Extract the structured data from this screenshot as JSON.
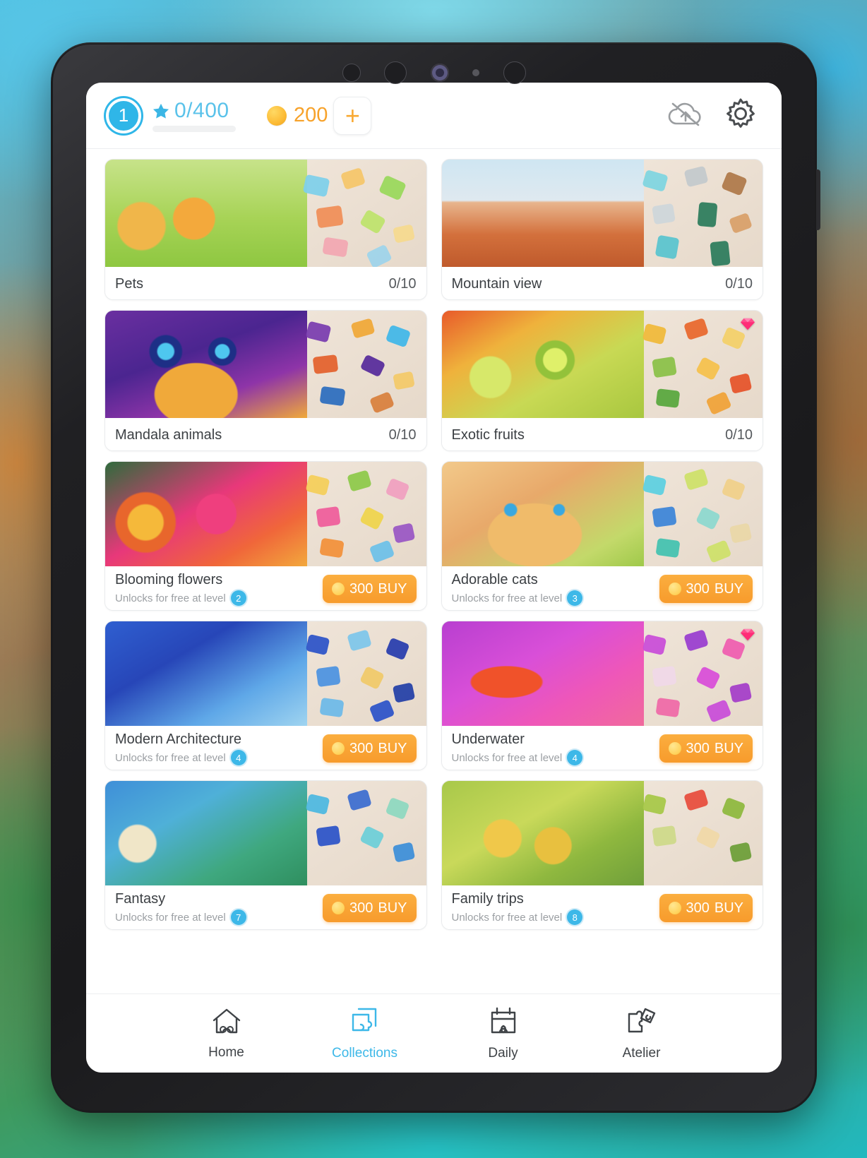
{
  "app": {
    "topbar": {
      "level": "1",
      "star_progress": "0/400",
      "star_icon": "star-icon",
      "coins": "200",
      "coin_icon": "coin-icon",
      "add_coins_label": "+",
      "cloud_off_icon": "cloud-off-icon",
      "settings_icon": "gear-icon"
    },
    "collections": [
      {
        "title": "Pets",
        "count": "0/10",
        "locked": false,
        "gem": false
      },
      {
        "title": "Mountain view",
        "count": "0/10",
        "locked": false,
        "gem": false
      },
      {
        "title": "Mandala animals",
        "count": "0/10",
        "locked": false,
        "gem": false
      },
      {
        "title": "Exotic fruits",
        "count": "0/10",
        "locked": false,
        "gem": true
      },
      {
        "title": "Blooming flowers",
        "unlock_text": "Unlocks for free at level",
        "unlock_level": "2",
        "price": "300",
        "buy_label": "BUY",
        "locked": true,
        "gem": false
      },
      {
        "title": "Adorable cats",
        "unlock_text": "Unlocks for free at level",
        "unlock_level": "3",
        "price": "300",
        "buy_label": "BUY",
        "locked": true,
        "gem": false
      },
      {
        "title": "Modern Architecture",
        "unlock_text": "Unlocks for free at level",
        "unlock_level": "4",
        "price": "300",
        "buy_label": "BUY",
        "locked": true,
        "gem": false
      },
      {
        "title": "Underwater",
        "unlock_text": "Unlocks for free at level",
        "unlock_level": "4",
        "price": "300",
        "buy_label": "BUY",
        "locked": true,
        "gem": true
      },
      {
        "title": "Fantasy",
        "unlock_text": "Unlocks for free at level",
        "unlock_level": "7",
        "price": "300",
        "buy_label": "BUY",
        "locked": true,
        "gem": false
      },
      {
        "title": "Family trips",
        "unlock_text": "Unlocks for free at level",
        "unlock_level": "8",
        "price": "300",
        "buy_label": "BUY",
        "locked": true,
        "gem": false
      }
    ],
    "nav": [
      {
        "label": "Home",
        "icon": "home-puzzle-icon",
        "active": false
      },
      {
        "label": "Collections",
        "icon": "collections-icon",
        "active": true
      },
      {
        "label": "Daily",
        "icon": "calendar-puzzle-icon",
        "active": false
      },
      {
        "label": "Atelier",
        "icon": "atelier-puzzle-icon",
        "active": false
      }
    ],
    "colors": {
      "accent_blue": "#3db8e8",
      "accent_orange": "#f79b2c",
      "coin_yellow": "#fcbb35",
      "text_dark": "#3b3f43",
      "text_muted": "#9b9fa3"
    }
  }
}
